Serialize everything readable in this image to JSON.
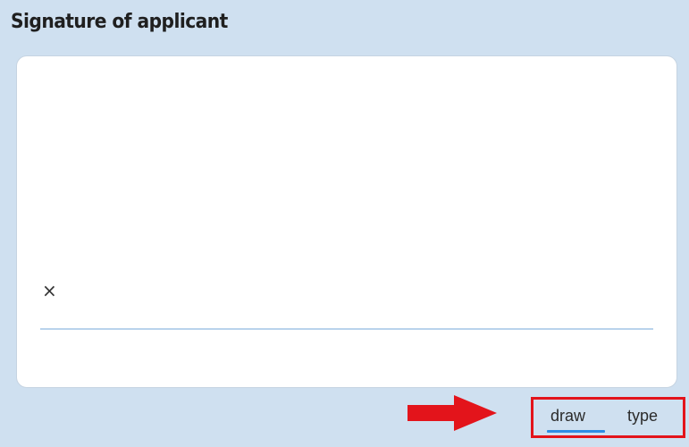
{
  "signature": {
    "title": "Signature of applicant",
    "x_mark": "×"
  },
  "mode_switch": {
    "draw_label": "draw",
    "type_label": "type",
    "active": "draw"
  },
  "icons": {
    "pointer_arrow": "arrow-right-icon"
  },
  "colors": {
    "panel_background": "#cfe0f0",
    "signature_box": "#ffffff",
    "signature_line": "#b9d3ec",
    "active_underline": "#2f8de4",
    "highlight_box": "#e3141b",
    "arrow": "#e3141b"
  }
}
